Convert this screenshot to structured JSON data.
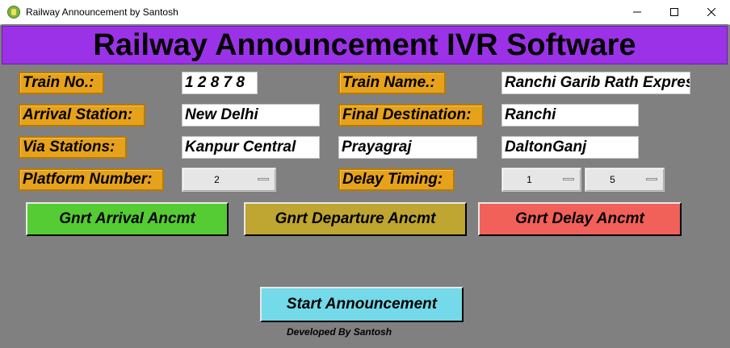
{
  "window": {
    "title": "Railway Announcement by Santosh"
  },
  "header": {
    "title": "Railway Announcement IVR Software"
  },
  "form": {
    "train_no_label": "Train No.:",
    "train_no_value": "1 2 8 7 8",
    "train_name_label": "Train Name.:",
    "train_name_value": "Ranchi Garib Rath Express",
    "arrival_label": "Arrival Station:",
    "arrival_value": "New Delhi",
    "final_dest_label": "Final Destination:",
    "final_dest_value": "Ranchi",
    "via_label": "Via Stations:",
    "via_1": "Kanpur Central",
    "via_2": "Prayagraj",
    "via_3": "DaltonGanj",
    "platform_label": "Platform Number:",
    "platform_value": "2",
    "delay_label": "Delay Timing:",
    "delay_hours": "1",
    "delay_minutes": "5"
  },
  "buttons": {
    "arrival": "Gnrt Arrival Ancmt",
    "departure": "Gnrt Departure Ancmt",
    "delay": "Gnrt Delay Ancmt",
    "start": "Start Announcement"
  },
  "footer": {
    "credit": "Developed By Santosh"
  },
  "colors": {
    "header_bg": "#9c32e8",
    "label_bg": "#e6a21a",
    "arrival_btn": "#55cc33",
    "departure_btn": "#bfa531",
    "delay_btn": "#f2605a",
    "start_btn": "#74d9e8",
    "background": "#808080"
  }
}
